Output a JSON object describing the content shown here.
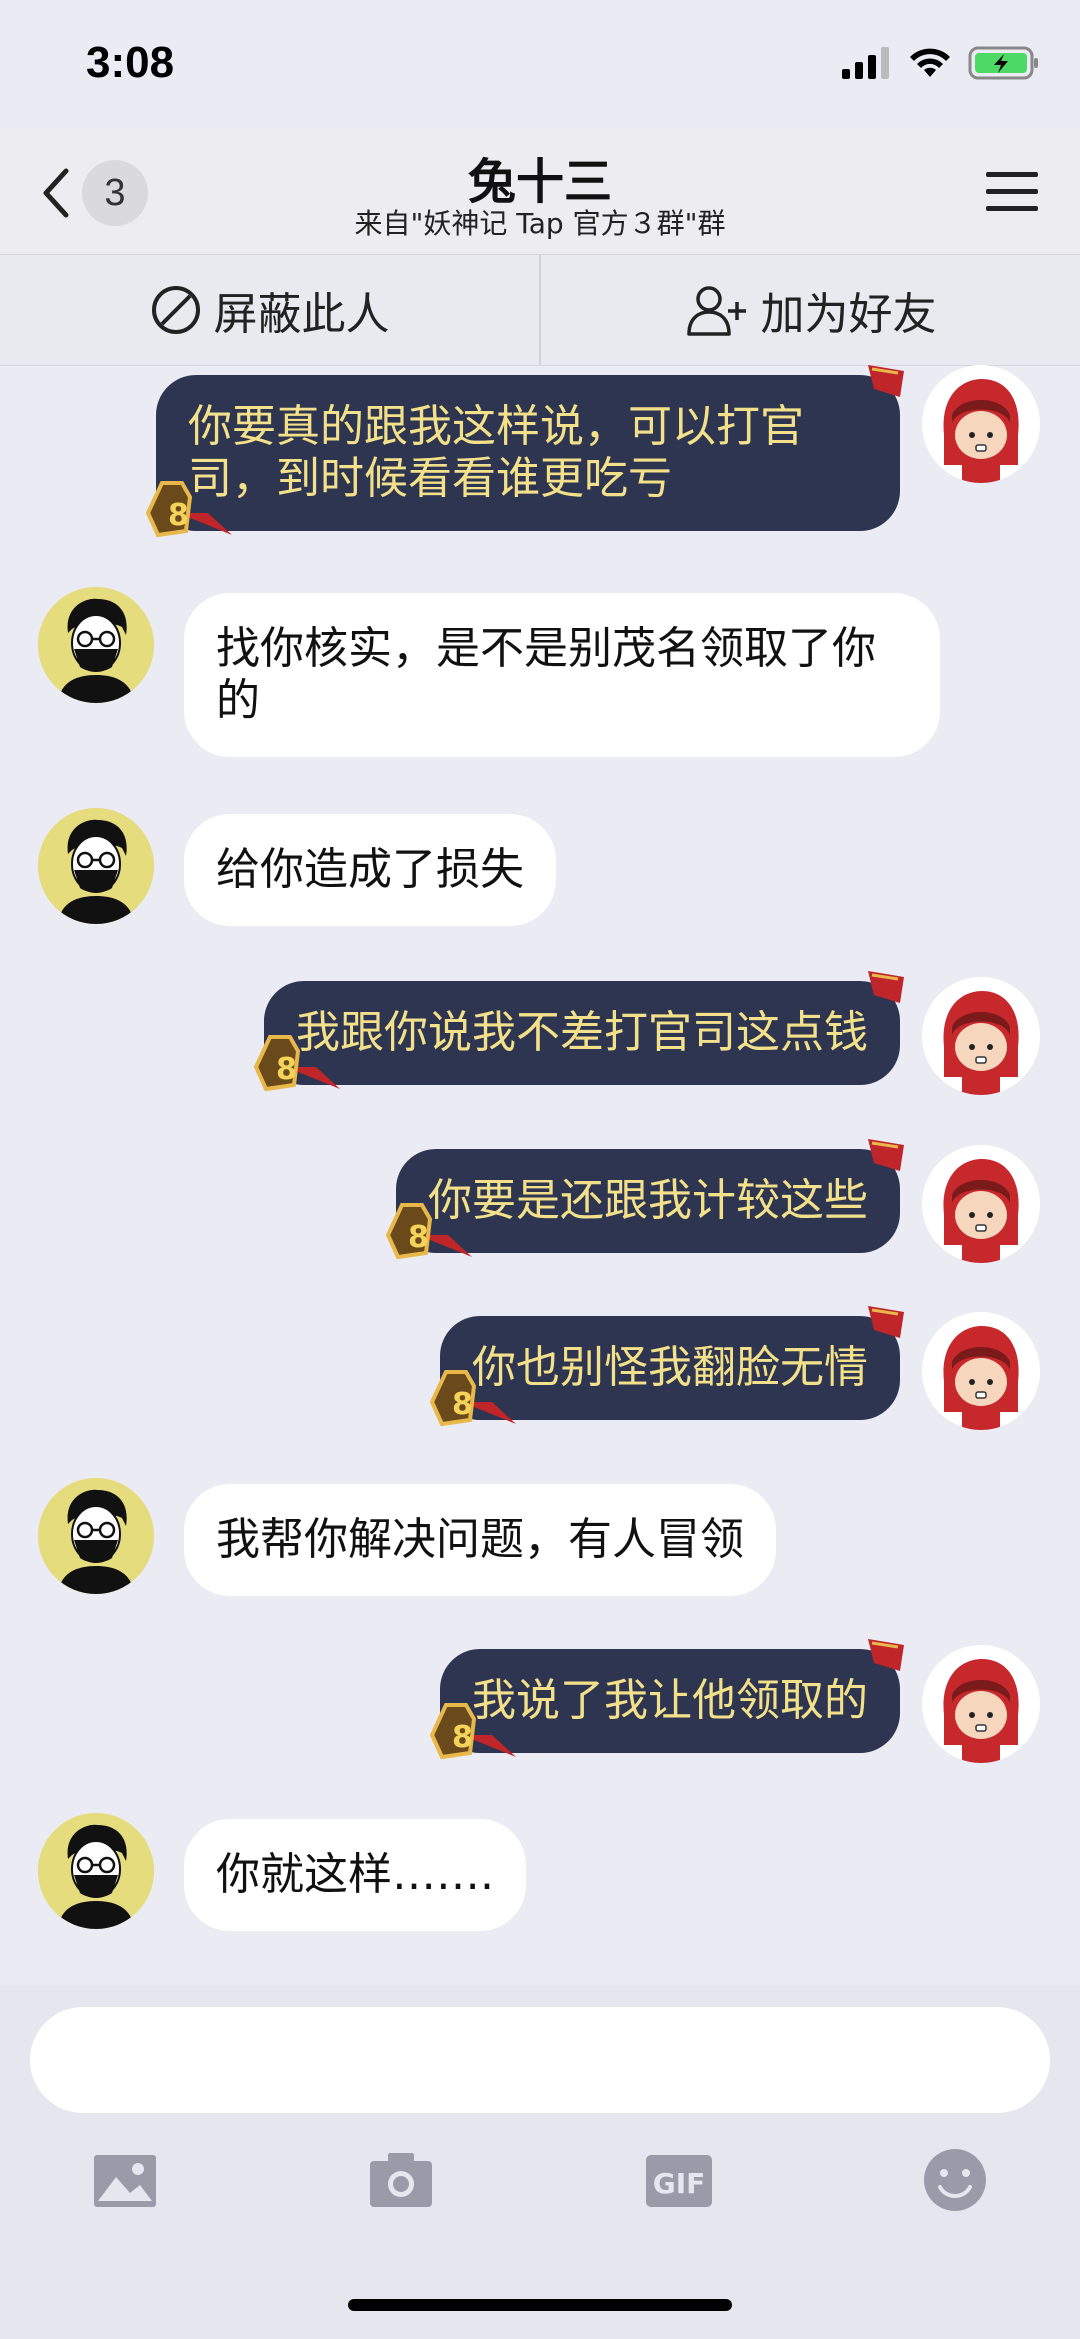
{
  "status_bar": {
    "time": "3:08"
  },
  "nav": {
    "back_count": "3",
    "title": "兔十三",
    "subtitle": "来自\"妖神记 Tap 官方３群\"群"
  },
  "actions": {
    "block_label": "屏蔽此人",
    "add_friend_label": "加为好友"
  },
  "messages": [
    {
      "side": "right",
      "text": "你要真的跟我这样说，可以打官司，到时候看看谁更吃亏"
    },
    {
      "side": "left",
      "text": "找你核实，是不是别茂名领取了你的"
    },
    {
      "side": "left",
      "text": "给你造成了损失"
    },
    {
      "side": "right",
      "text": "我跟你说我不差打官司这点钱"
    },
    {
      "side": "right",
      "text": "你要是还跟我计较这些"
    },
    {
      "side": "right",
      "text": "你也别怪我翻脸无情"
    },
    {
      "side": "left",
      "text": "我帮你解决问题，有人冒领"
    },
    {
      "side": "right",
      "text": "我说了我让他领取的"
    },
    {
      "side": "left",
      "text": "你就这样……."
    }
  ],
  "input": {
    "placeholder": ""
  },
  "toolbar": {
    "icons": [
      "image-icon",
      "camera-icon",
      "gif-icon",
      "emoji-icon"
    ],
    "gif_label": "GIF"
  },
  "colors": {
    "my_bubble": "#2e3550",
    "my_text": "#f3e08a",
    "other_bubble": "#ffffff",
    "background": "#ebebf3"
  }
}
